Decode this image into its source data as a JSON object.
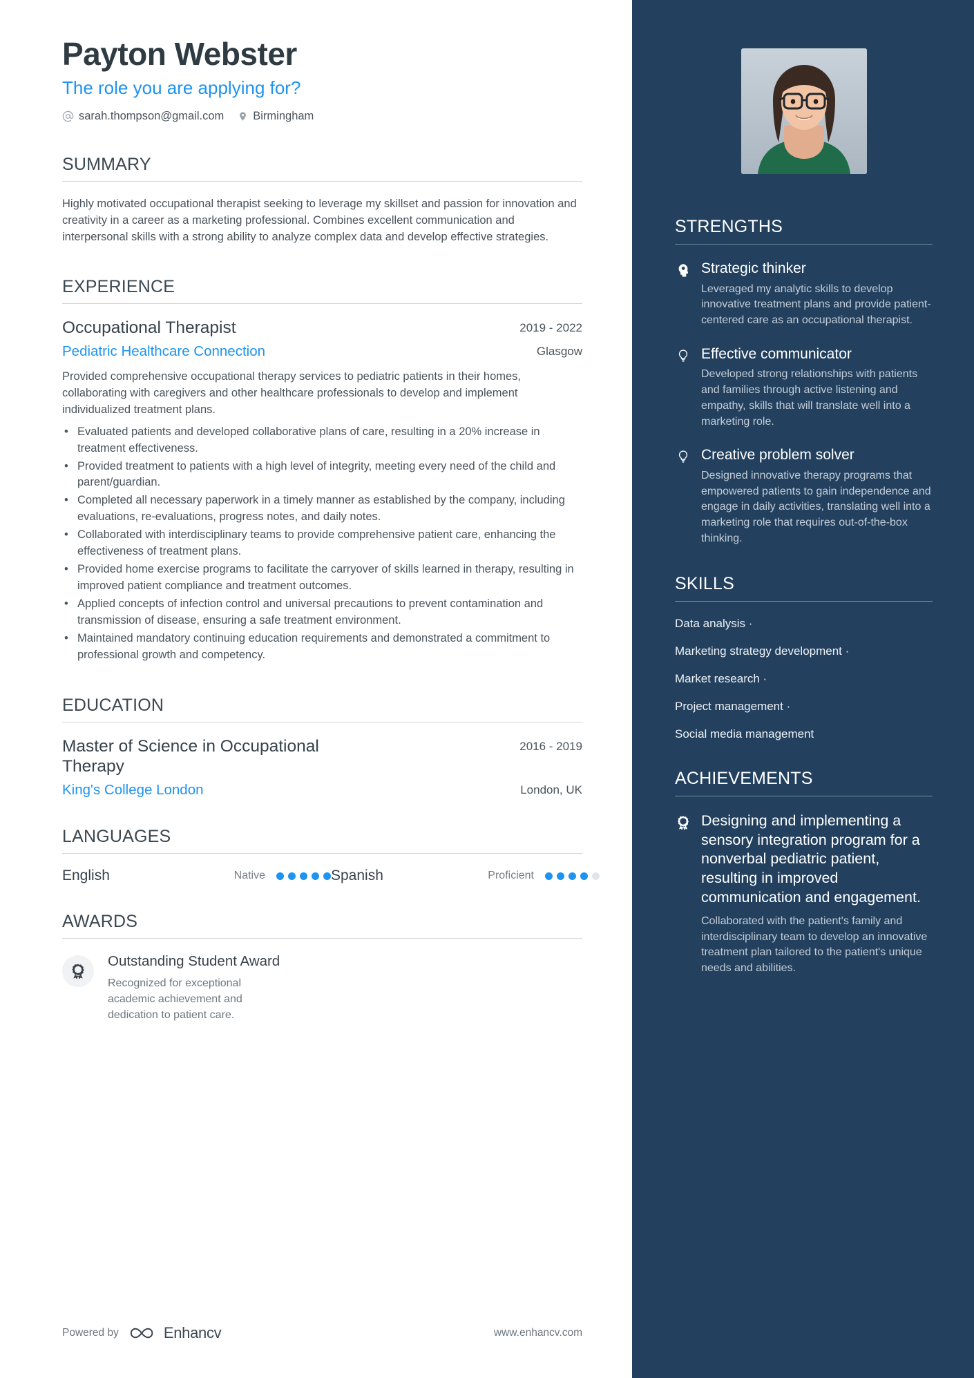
{
  "header": {
    "name": "Payton Webster",
    "role": "The role you are applying for?",
    "email": "sarah.thompson@gmail.com",
    "location": "Birmingham",
    "email_icon": "at-sign-icon",
    "location_icon": "map-pin-icon"
  },
  "summary": {
    "title": "SUMMARY",
    "text": "Highly motivated occupational therapist seeking to leverage my skillset and passion for innovation and creativity in a career as a marketing professional. Combines excellent communication and interpersonal skills with a strong ability to analyze complex data and develop effective strategies."
  },
  "experience": {
    "title": "EXPERIENCE",
    "entries": [
      {
        "job_title": "Occupational Therapist",
        "date": "2019 - 2022",
        "organization": "Pediatric Healthcare Connection",
        "location": "Glasgow",
        "description": "Provided comprehensive occupational therapy services to pediatric patients in their homes, collaborating with caregivers and other healthcare professionals to develop and implement individualized treatment plans.",
        "bullets": [
          "Evaluated patients and developed collaborative plans of care, resulting in a 20% increase in treatment effectiveness.",
          "Provided treatment to patients with a high level of integrity, meeting every need of the child and parent/guardian.",
          "Completed all necessary paperwork in a timely manner as established by the company, including evaluations, re-evaluations, progress notes, and daily notes.",
          "Collaborated with interdisciplinary teams to provide comprehensive patient care, enhancing the effectiveness of treatment plans.",
          "Provided home exercise programs to facilitate the carryover of skills learned in therapy, resulting in improved patient compliance and treatment outcomes.",
          "Applied concepts of infection control and universal precautions to prevent contamination and transmission of disease, ensuring a safe treatment environment.",
          "Maintained mandatory continuing education requirements and demonstrated a commitment to professional growth and competency."
        ]
      }
    ]
  },
  "education": {
    "title": "EDUCATION",
    "entries": [
      {
        "degree": "Master of Science in Occupational Therapy",
        "date": "2016 - 2019",
        "institution": "King's College London",
        "location": "London, UK"
      }
    ]
  },
  "languages": {
    "title": "LANGUAGES",
    "items": [
      {
        "name": "English",
        "level": "Native",
        "filled": 5,
        "total": 5
      },
      {
        "name": "Spanish",
        "level": "Proficient",
        "filled": 4,
        "total": 5
      }
    ]
  },
  "awards": {
    "title": "AWARDS",
    "items": [
      {
        "icon": "award-ribbon-icon",
        "name": "Outstanding Student Award",
        "description": "Recognized for exceptional academic achievement and dedication to patient care."
      }
    ]
  },
  "strengths": {
    "title": "STRENGTHS",
    "items": [
      {
        "icon": "head-bulb-icon",
        "name": "Strategic thinker",
        "description": "Leveraged my analytic skills to develop innovative treatment plans and provide patient-centered care as an occupational therapist."
      },
      {
        "icon": "lightbulb-icon",
        "name": "Effective communicator",
        "description": "Developed strong relationships with patients and families through active listening and empathy, skills that will translate well into a marketing role."
      },
      {
        "icon": "lightbulb-icon",
        "name": "Creative problem solver",
        "description": "Designed innovative therapy programs that empowered patients to gain independence and engage in daily activities, translating well into a marketing role that requires out-of-the-box thinking."
      }
    ]
  },
  "skills": {
    "title": "SKILLS",
    "items": [
      "Data analysis ·",
      "Marketing strategy development ·",
      "Market research ·",
      "Project management ·",
      "Social media management"
    ]
  },
  "achievements": {
    "title": "ACHIEVEMENTS",
    "items": [
      {
        "icon": "award-ribbon-icon",
        "name": "Designing and implementing a sensory integration program for a nonverbal pediatric patient, resulting in improved communication and engagement.",
        "description": "Collaborated with the patient's family and interdisciplinary team to develop an innovative treatment plan tailored to the patient's unique needs and abilities."
      }
    ]
  },
  "footer": {
    "powered_by": "Powered by",
    "brand": "Enhancv",
    "website": "www.enhancv.com",
    "logo_icon": "enhancv-infinity-icon"
  },
  "colors": {
    "accent_blue": "#1e93ef",
    "sidebar_bg": "#23415f",
    "heading": "#3b4751",
    "body_text": "#4a545c"
  }
}
